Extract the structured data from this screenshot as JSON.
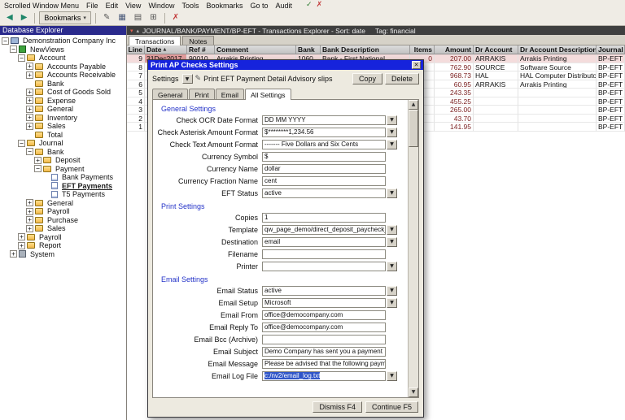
{
  "menu": {
    "items": [
      "Scrolled Window Menu",
      "File",
      "Edit",
      "View",
      "Window",
      "Tools",
      "Bookmarks",
      "Go to",
      "Audit"
    ],
    "icons": [
      {
        "name": "audit-check",
        "glyph": "✓",
        "color": "#2f7d32"
      },
      {
        "name": "audit-clear",
        "glyph": "✗",
        "color": "#c23a3a"
      }
    ]
  },
  "toolbar": {
    "buttons": [
      {
        "name": "nav-back",
        "glyph": "◀",
        "color": "#20876a"
      },
      {
        "name": "nav-forward",
        "glyph": "▶",
        "color": "#20876a"
      },
      {
        "name": "separator"
      },
      {
        "name": "bookmarks-dropdown",
        "label": "Bookmarks",
        "glyph": "▾"
      },
      {
        "name": "separator"
      },
      {
        "name": "edit-annotation",
        "glyph": "✎",
        "color": "#555555"
      },
      {
        "name": "window-grid",
        "glyph": "▦",
        "color": "#4a5a7a"
      },
      {
        "name": "print",
        "glyph": "▤",
        "color": "#555555"
      },
      {
        "name": "calculator",
        "glyph": "⊞",
        "color": "#555555"
      },
      {
        "name": "separator"
      },
      {
        "name": "clear-audit-marks",
        "glyph": "✗",
        "color": "#c23a3a"
      }
    ]
  },
  "explorer": {
    "title": "Database Explorer",
    "items": [
      {
        "label": "Demonstration Company Inc",
        "indent": 0,
        "box": "minus",
        "icon": "company"
      },
      {
        "label": "NewViews",
        "indent": 1,
        "box": "minus",
        "icon": "nv"
      },
      {
        "label": "Account",
        "indent": 2,
        "box": "minus",
        "icon": "folder"
      },
      {
        "label": "Accounts Payable",
        "indent": 3,
        "box": "plus",
        "icon": "folder"
      },
      {
        "label": "Accounts Receivable",
        "indent": 3,
        "box": "plus",
        "icon": "folder"
      },
      {
        "label": "Bank",
        "indent": 3,
        "box": "none",
        "icon": "folder"
      },
      {
        "label": "Cost of Goods Sold",
        "indent": 3,
        "box": "plus",
        "icon": "folder"
      },
      {
        "label": "Expense",
        "indent": 3,
        "box": "plus",
        "icon": "folder"
      },
      {
        "label": "General",
        "indent": 3,
        "box": "plus",
        "icon": "folder"
      },
      {
        "label": "Inventory",
        "indent": 3,
        "box": "plus",
        "icon": "folder"
      },
      {
        "label": "Sales",
        "indent": 3,
        "box": "plus",
        "icon": "folder"
      },
      {
        "label": "Total",
        "indent": 3,
        "box": "none",
        "icon": "folder"
      },
      {
        "label": "Journal",
        "indent": 2,
        "box": "minus",
        "icon": "folder"
      },
      {
        "label": "Bank",
        "indent": 3,
        "box": "minus",
        "icon": "folder"
      },
      {
        "label": "Deposit",
        "indent": 4,
        "box": "plus",
        "icon": "folder"
      },
      {
        "label": "Payment",
        "indent": 4,
        "box": "minus",
        "icon": "folder"
      },
      {
        "label": "Bank Payments",
        "indent": 5,
        "box": "none",
        "icon": "doc"
      },
      {
        "label": "EFT Payments",
        "indent": 5,
        "box": "none",
        "icon": "doc",
        "selected": true
      },
      {
        "label": "T5 Payments",
        "indent": 5,
        "box": "none",
        "icon": "doc"
      },
      {
        "label": "General",
        "indent": 3,
        "box": "plus",
        "icon": "folder"
      },
      {
        "label": "Payroll",
        "indent": 3,
        "box": "plus",
        "icon": "folder"
      },
      {
        "label": "Purchase",
        "indent": 3,
        "box": "plus",
        "icon": "folder"
      },
      {
        "label": "Sales",
        "indent": 3,
        "box": "plus",
        "icon": "folder"
      },
      {
        "label": "Payroll",
        "indent": 2,
        "box": "plus",
        "icon": "folder"
      },
      {
        "label": "Report",
        "indent": 2,
        "box": "plus",
        "icon": "folder"
      },
      {
        "label": "System",
        "indent": 1,
        "box": "plus",
        "icon": "system"
      }
    ]
  },
  "transactions": {
    "title": "JOURNAL/BANK/PAYMENT/BP-EFT - Transactions Explorer - Sort: date",
    "tag": "Tag: financial",
    "tabs": [
      {
        "label": "Transactions",
        "active": true
      },
      {
        "label": "Notes",
        "active": false
      }
    ],
    "columns": [
      {
        "label": "Line",
        "align": "right"
      },
      {
        "label": "Date",
        "sorted": true
      },
      {
        "label": "Ref #"
      },
      {
        "label": "Comment"
      },
      {
        "label": "Bank"
      },
      {
        "label": "Bank Description"
      },
      {
        "label": "Items",
        "align": "right",
        "numeric": true
      },
      {
        "label": "Amount",
        "align": "right",
        "numeric": true
      },
      {
        "label": "Dr Account"
      },
      {
        "label": "Dr Account Description"
      },
      {
        "label": "Journal"
      }
    ],
    "rows": [
      {
        "selected": true,
        "cells": [
          "9",
          "31Dec2017",
          "90010",
          "Arrakis Printing",
          "1060",
          "Bank - First National",
          "0",
          "207.00",
          "ARRAKIS",
          "Arrakis Printing",
          "BP-EFT"
        ]
      },
      {
        "cells": [
          "8",
          "",
          "",
          "",
          "",
          "",
          "",
          "762.90",
          "SOURCE",
          "Software Source",
          "BP-EFT"
        ]
      },
      {
        "cells": [
          "7",
          "",
          "",
          "",
          "",
          "",
          "",
          "968.73",
          "HAL",
          "HAL Computer Distributors",
          "BP-EFT"
        ]
      },
      {
        "cells": [
          "6",
          "",
          "",
          "",
          "",
          "",
          "",
          "60.95",
          "ARRAKIS",
          "Arrakis Printing",
          "BP-EFT"
        ]
      },
      {
        "cells": [
          "5",
          "",
          "",
          "",
          "",
          "",
          "",
          "243.35",
          "",
          "",
          "BP-EFT"
        ]
      },
      {
        "cells": [
          "4",
          "",
          "",
          "",
          "",
          "",
          "",
          "455.25",
          "",
          "",
          "BP-EFT"
        ]
      },
      {
        "cells": [
          "3",
          "",
          "",
          "",
          "",
          "",
          "",
          "265.00",
          "",
          "",
          "BP-EFT"
        ]
      },
      {
        "cells": [
          "2",
          "",
          "",
          "",
          "",
          "",
          "",
          "43.70",
          "",
          "",
          "BP-EFT"
        ]
      },
      {
        "cells": [
          "1",
          "",
          "",
          "",
          "",
          "",
          "",
          "141.95",
          "",
          "",
          "BP-EFT"
        ]
      }
    ]
  },
  "dialog": {
    "title": "Print AP Checks Settings",
    "settings_label": "Settings",
    "setting_name": "Print EFT Payment Detail Advisory slips",
    "copy_label": "Copy",
    "delete_label": "Delete",
    "tabs": [
      {
        "label": "General"
      },
      {
        "label": "Print"
      },
      {
        "label": "Email"
      },
      {
        "label": "All Settings",
        "active": true
      }
    ],
    "sections": [
      {
        "heading": "General Settings",
        "fields": [
          {
            "label": "Check OCR Date Format",
            "value": "DD MM YYYY",
            "dropdown": true
          },
          {
            "label": "Check Asterisk Amount Format",
            "value": "$********1,234.56",
            "dropdown": true
          },
          {
            "label": "Check Text Amount Format",
            "value": "------- Five Dollars and Six Cents",
            "dropdown": true
          },
          {
            "label": "Currency Symbol",
            "value": "$"
          },
          {
            "label": "Currency Name",
            "value": "dollar"
          },
          {
            "label": "Currency Fraction Name",
            "value": "cent"
          },
          {
            "label": "EFT Status",
            "value": "active",
            "dropdown": true
          }
        ]
      },
      {
        "heading": "Print Settings",
        "fields": [
          {
            "label": "Copies",
            "value": "1"
          },
          {
            "label": "Template",
            "value": "qw_page_demo/direct_deposit_paycheck_detail_stub.xls",
            "dropdown": true
          },
          {
            "label": "Destination",
            "value": "email",
            "dropdown": true
          },
          {
            "label": "Filename",
            "value": ""
          },
          {
            "label": "Printer",
            "value": "",
            "dropdown": true
          }
        ]
      },
      {
        "heading": "Email Settings",
        "fields": [
          {
            "label": "Email Status",
            "value": "active",
            "dropdown": true
          },
          {
            "label": "Email Setup",
            "value": "Microsoft",
            "dropdown": true
          },
          {
            "label": "Email From",
            "value": "office@democompany.com"
          },
          {
            "label": "Email Reply To",
            "value": "office@democompany.com"
          },
          {
            "label": "Email Bcc (Archive)",
            "value": ""
          },
          {
            "label": "Email Subject",
            "value": "Demo Company has sent you a payment"
          },
          {
            "label": "Email Message",
            "value": "Please be advised that the following payment has been sent to you by EFT"
          },
          {
            "label": "Email Log File",
            "value": "c:/nv2/email_log.txt",
            "dropdown": true,
            "selected": true
          }
        ]
      }
    ],
    "dismiss_label": "Dismiss F4",
    "continue_label": "Continue F5",
    "accent_color": "#1623dc"
  }
}
